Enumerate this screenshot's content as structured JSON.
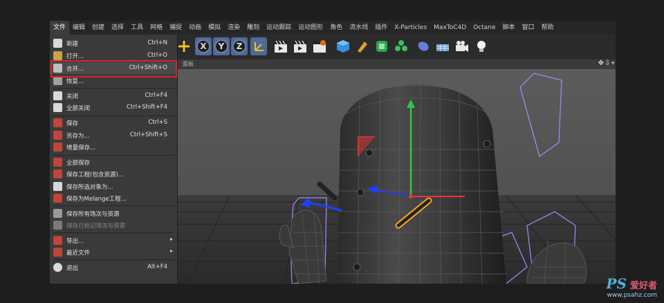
{
  "menubar": {
    "items": [
      "文件",
      "编辑",
      "创建",
      "选择",
      "工具",
      "网格",
      "捕捉",
      "动画",
      "模拟",
      "渲染",
      "雕刻",
      "运动跟踪",
      "运动图形",
      "角色",
      "流水线",
      "插件",
      "X-Particles",
      "MaxToC4D",
      "Octane",
      "脚本",
      "窗口",
      "帮助"
    ],
    "active_index": 0
  },
  "toolbar": {
    "axis_x": "X",
    "axis_y": "Y",
    "axis_z": "Z"
  },
  "viewport": {
    "panel_label": "面板",
    "nav_icons": "✥⇩⌖"
  },
  "file_menu": {
    "items": [
      {
        "label": "新建",
        "shortcut": "Ctrl+N",
        "icon": "new-file-icon",
        "color": "#d9d9d9"
      },
      {
        "label": "打开...",
        "shortcut": "Ctrl+O",
        "icon": "open-file-icon",
        "color": "#c9a24a"
      },
      {
        "label": "合并...",
        "shortcut": "Ctrl+Shift+O",
        "icon": "merge-icon",
        "color": "#bfbfbf"
      },
      {
        "label": "恢复...",
        "shortcut": "",
        "icon": "revert-icon",
        "color": "#a0a0a0"
      },
      {
        "label": "关闭",
        "shortcut": "Ctrl+F4",
        "icon": "close-file-icon",
        "color": "#d9d9d9"
      },
      {
        "label": "全部关闭",
        "shortcut": "Ctrl+Shift+F4",
        "icon": "close-all-icon",
        "color": "#d9d9d9"
      },
      {
        "label": "保存",
        "shortcut": "Ctrl+S",
        "icon": "save-icon",
        "color": "#c0453a"
      },
      {
        "label": "另存为...",
        "shortcut": "Ctrl+Shift+S",
        "icon": "save-as-icon",
        "color": "#c0453a"
      },
      {
        "label": "增量保存...",
        "shortcut": "",
        "icon": "incremental-save-icon",
        "color": "#c0453a"
      },
      {
        "label": "全部保存",
        "shortcut": "",
        "icon": "save-all-icon",
        "color": "#c0453a"
      },
      {
        "label": "保存工程(包含资源)...",
        "shortcut": "",
        "icon": "save-project-icon",
        "color": "#c0453a"
      },
      {
        "label": "保存所选对象为...",
        "shortcut": "",
        "icon": "save-selected-icon",
        "color": "#d9d9d9"
      },
      {
        "label": "保存为Melange工程...",
        "shortcut": "",
        "icon": "melange-icon",
        "color": "#c0453a"
      },
      {
        "label": "保存所有场次与资源",
        "shortcut": "",
        "icon": "save-takes-icon",
        "color": "#9a9a9a"
      },
      {
        "label": "保存已标记场次与资源",
        "shortcut": "",
        "icon": "save-marked-takes-icon",
        "color": "#7a7a7a"
      },
      {
        "label": "导出...",
        "shortcut": "",
        "icon": "export-icon",
        "color": "#c0453a"
      },
      {
        "label": "最近文件",
        "shortcut": "",
        "icon": "recent-files-icon",
        "color": "#c0453a"
      },
      {
        "label": "退出",
        "shortcut": "Alt+F4",
        "icon": "power-icon",
        "color": "#d9d9d9"
      }
    ]
  },
  "watermark": {
    "brand": "PS",
    "cn": "爱好者",
    "url": "www.psahz.com"
  },
  "colors": {
    "highlight_box": "#d8262a",
    "y_axis": "#2ecc40",
    "x_axis": "#e53935",
    "z_axis": "#1e40ff",
    "selection": "#f5a623",
    "wireframe_guides": "#a48cff"
  }
}
